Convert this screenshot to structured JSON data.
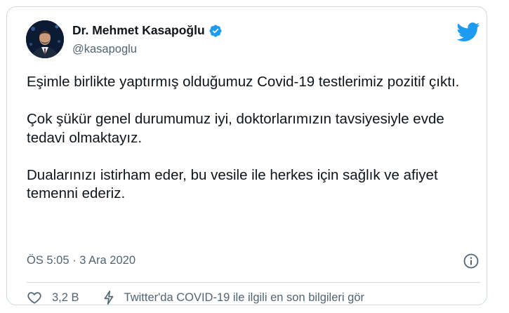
{
  "author": {
    "name": "Dr. Mehmet Kasapoğlu",
    "handle": "@kasapoglu"
  },
  "tweet": {
    "paragraphs": [
      "Eşimle birlikte yaptırmış olduğumuz Covid-19 testlerimiz pozitif çıktı.",
      "Çok şükür genel durumumuz iyi, doktorlarımızın tavsiyesiyle evde tedavi olmaktayız.",
      "Dualarınızı istirham eder, bu vesile ile herkes için sağlık ve afiyet temenni ederiz."
    ],
    "timestamp": "ÖS 5:05 · 3 Ara 2020"
  },
  "actions": {
    "like_count": "3,2 B",
    "covid_link": "Twitter'da COVID-19 ile ilgili en son bilgileri gör"
  },
  "icons": {
    "verified": "verified-badge-icon",
    "bird": "twitter-bird-icon",
    "info": "info-icon",
    "like": "heart-icon",
    "covid": "lightning-icon"
  },
  "colors": {
    "brand": "#1d9bf0",
    "text": "#0f1419",
    "muted": "#536471",
    "border": "#cfd9de"
  }
}
